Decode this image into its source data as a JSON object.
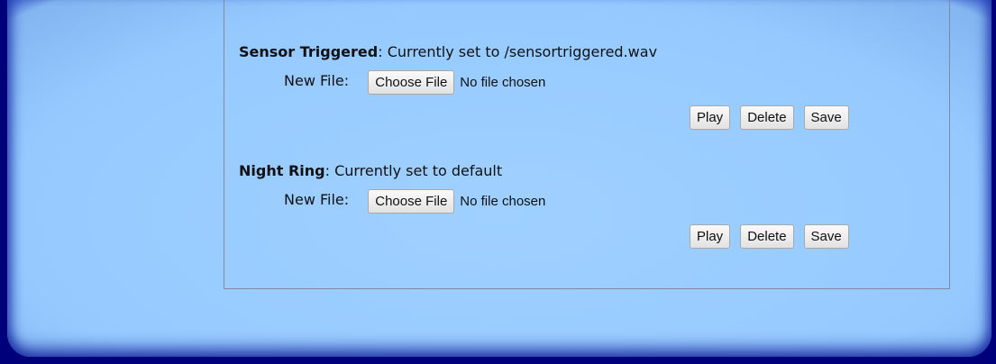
{
  "sections": [
    {
      "name": "Sensor Triggered",
      "status": ": Currently set to /sensortriggered.wav",
      "new_file_label": "New File:",
      "choose_label": "Choose File",
      "no_file_text": "No file chosen",
      "play_label": "Play",
      "delete_label": "Delete",
      "save_label": "Save"
    },
    {
      "name": "Night Ring",
      "status": ": Currently set to default",
      "new_file_label": "New File:",
      "choose_label": "Choose File",
      "no_file_text": "No file chosen",
      "play_label": "Play",
      "delete_label": "Delete",
      "save_label": "Save"
    }
  ]
}
